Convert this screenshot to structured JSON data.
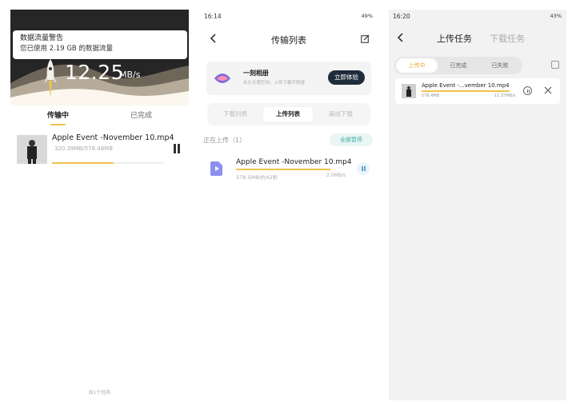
{
  "panel1": {
    "notification": {
      "title": "数据流量警告",
      "body": "您已使用 2.19 GB 的数据流量"
    },
    "speed": {
      "value": "12.25",
      "unit": "MB/s"
    },
    "tabs": [
      {
        "label": "传输中",
        "active": true
      },
      {
        "label": "已完成",
        "active": false
      }
    ],
    "task": {
      "name": "Apple Event -November 10.mp4",
      "size": "320.39MB/578.48MB",
      "progress": 0.554
    },
    "footer": "共1个任务",
    "colors": {
      "hero_bg": "#262626",
      "accent": "#f2c34a"
    }
  },
  "panel2": {
    "status": {
      "time": "16:14",
      "right": "49%"
    },
    "title": "传输列表",
    "promo": {
      "title": "一刻相册",
      "subtitle": "永久无限空间，上传下载不限速",
      "button": "立即体验"
    },
    "segments": [
      {
        "label": "下载列表"
      },
      {
        "label": "上传列表",
        "active": true
      },
      {
        "label": "离线下载"
      }
    ],
    "section": {
      "label": "正在上传（1）",
      "pause_all": "全部暂停"
    },
    "task": {
      "name": "Apple Event -November 10.mp4",
      "size": "578.5MB/约42秒",
      "rate": "2.0MB/s",
      "progress": 0.98
    },
    "colors": {
      "promo_btn": "#1f2c3c",
      "pause_all_text": "#3fa99b"
    }
  },
  "panel3": {
    "status": {
      "time": "16:20",
      "right": "43%"
    },
    "tabs": [
      {
        "label": "上传任务",
        "active": true
      },
      {
        "label": "下载任务",
        "active": false
      }
    ],
    "segments": [
      {
        "label": "上传中",
        "active": true
      },
      {
        "label": "已完成"
      },
      {
        "label": "已失败"
      }
    ],
    "task": {
      "name": "Apple Event -...vember 10.mp4",
      "size": "578.4MB",
      "rate": "11.37MB/s",
      "progress": 1.0
    },
    "colors": {
      "active_segment_text": "#f0a52c",
      "background": "#f2f2f2"
    }
  }
}
